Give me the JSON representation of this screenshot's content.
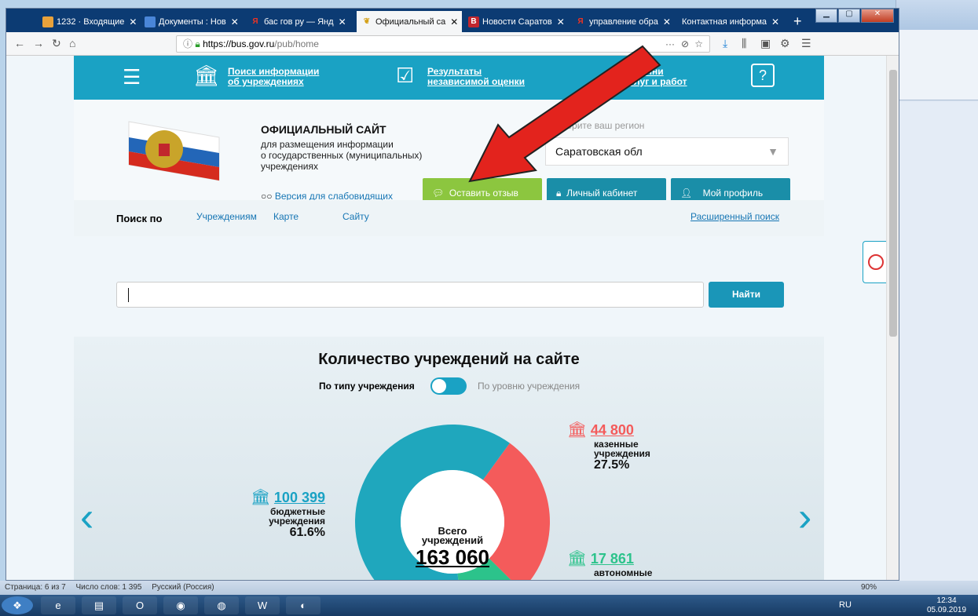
{
  "tabs": [
    {
      "label": "1232 · Входящие",
      "icon": "mail-icon",
      "color": "#e9a23b"
    },
    {
      "label": "Документы : Нов",
      "icon": "doc-icon",
      "color": "#4a86d8"
    },
    {
      "label": "бас гов ру — Янд",
      "icon": "yandex-icon",
      "color": "#e32"
    },
    {
      "label": "Официальный са",
      "icon": "emblem-icon",
      "color": "#d4a017"
    },
    {
      "label": "Новости Саратов",
      "icon": "b-icon",
      "color": "#c2262e"
    },
    {
      "label": "управление обра",
      "icon": "yandex-icon",
      "color": "#e32"
    },
    {
      "label": "Контактная информа",
      "icon": "page-icon",
      "color": "#6a7"
    }
  ],
  "url": {
    "host": "https://bus.gov.ru",
    "path": "/pub/home"
  },
  "topnav": [
    {
      "line1": "Поиск информации",
      "line2": "об учреждениях"
    },
    {
      "line1": "Результаты",
      "line2": "независимой оценки"
    },
    {
      "line1": "Перечни",
      "line2": "услуг и работ"
    }
  ],
  "header": {
    "title": "ОФИЦИАЛЬНЫЙ САЙТ",
    "sub1": "для размещения информации",
    "sub2": "о государственных (муниципальных)",
    "sub3": "учреждениях",
    "weak_version": "Версия для слабовидящих",
    "region_label": "Выберите ваш регион",
    "region_value": "Саратовская обл"
  },
  "buttons": {
    "feedback": "Оставить отзыв",
    "cabinet": "Личный кабинет",
    "profile": "Мой профиль"
  },
  "search": {
    "label": "Поиск по",
    "opt1": "Учреждениям",
    "opt2": "Карте",
    "opt3": "Сайту",
    "advanced": "Расширенный поиск",
    "find": "Найти"
  },
  "stats": {
    "title": "Количество учреждений на сайте",
    "toggle_left": "По типу учреждения",
    "toggle_right": "По уровню учреждения",
    "total_label1": "Всего",
    "total_label2": "учреждений",
    "total": "163 060",
    "kazennye_num": "44 800",
    "kazennye_l1": "казенные",
    "kazennye_l2": "учреждения",
    "kazennye_pct": "27.5%",
    "budget_num": "100 399",
    "budget_l1": "бюджетные",
    "budget_l2": "учреждения",
    "budget_pct": "61.6%",
    "auto_num": "17 861",
    "auto_l1": "автономные"
  },
  "chart_data": {
    "type": "pie",
    "categories": [
      "бюджетные",
      "казенные",
      "автономные"
    ],
    "values": [
      100399,
      44800,
      17861
    ],
    "colors": [
      "#1fa7bd",
      "#f45b5b",
      "#2cc38b"
    ]
  },
  "statusbar": {
    "page": "Страница: 6 из 7",
    "words": "Число слов: 1 395",
    "lang": "Русский (Россия)",
    "zoom": "90%"
  },
  "tray": {
    "lang": "RU",
    "time": "12:34",
    "date": "05.09.2019"
  }
}
